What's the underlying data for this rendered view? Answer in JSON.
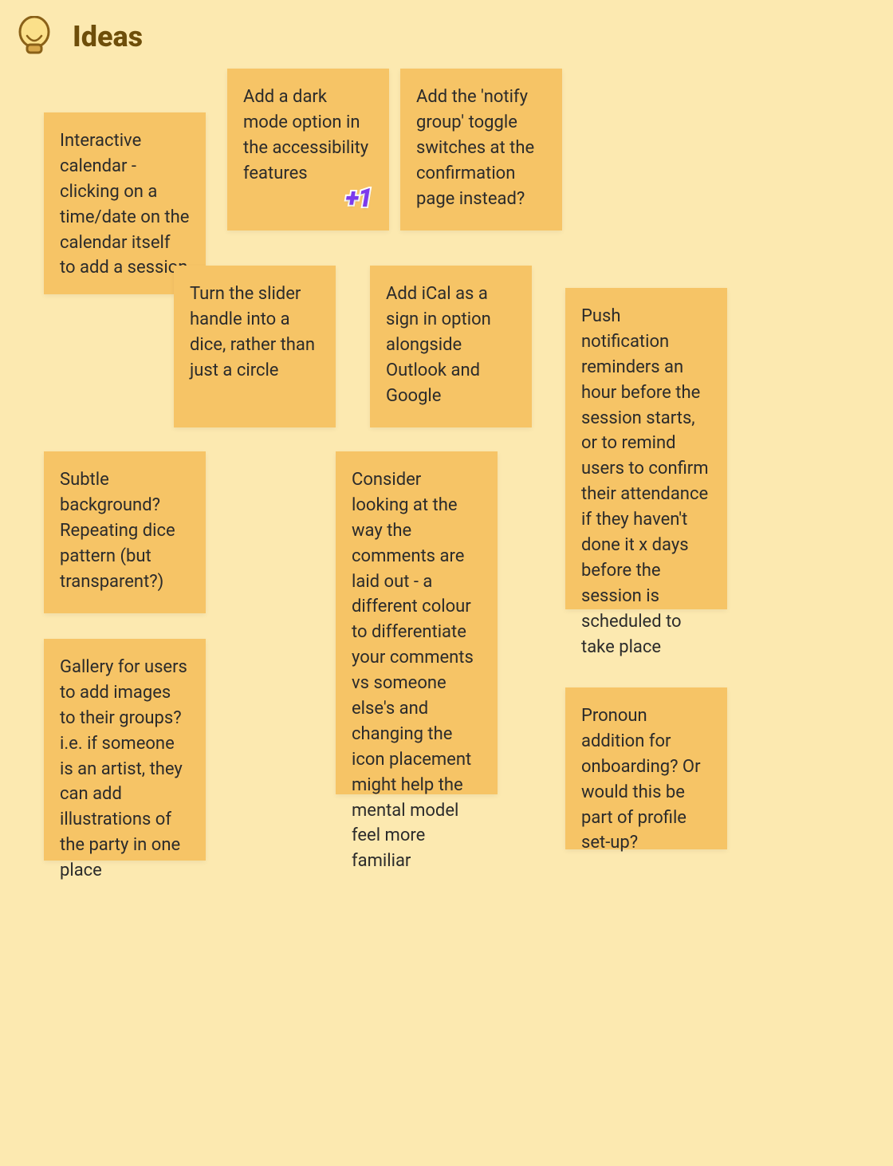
{
  "header": {
    "title": "Ideas"
  },
  "notes": {
    "interactive_calendar": "Interactive calendar - clicking on a time/date on the calendar itself to add a session",
    "dark_mode": "Add a dark mode option in the accessibility features",
    "notify_group": "Add the 'notify group' toggle switches at the confirmation page instead?",
    "slider_dice": "Turn the slider handle into a dice, rather than just a circle",
    "ical": "Add iCal as a sign in option alongside Outlook and Google",
    "push_notification": "Push notification reminders an hour before the session starts, or to remind users to confirm their attendance if they haven't done it x days before the session is scheduled to take place",
    "subtle_bg": "Subtle background? Repeating dice pattern (but transparent?)",
    "comments_layout": "Consider looking at the way the comments are laid out - a different colour to differentiate your comments vs someone else's and changing the icon placement might help the mental model feel more familiar",
    "gallery": "Gallery for users to add images to their groups? i.e. if someone is an artist, they can add illustrations of the party in one place",
    "pronoun": "Pronoun addition for onboarding? Or would this be part of profile set-up?"
  },
  "badges": {
    "plus_one": "+1"
  }
}
